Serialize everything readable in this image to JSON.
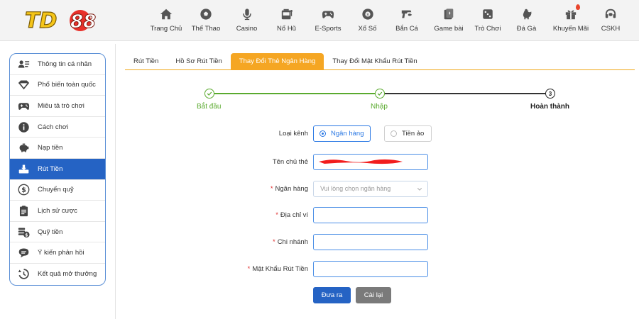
{
  "brand": {
    "logo_text": "TD88",
    "logo_color": "#f5c518"
  },
  "nav": [
    {
      "label": "Trang Chủ",
      "icon": "home-icon"
    },
    {
      "label": "Thể Thao",
      "icon": "soccer-ball-icon"
    },
    {
      "label": "Casino",
      "icon": "microphone-icon"
    },
    {
      "label": "Nổ Hũ",
      "icon": "slot-machine-icon"
    },
    {
      "label": "E-Sports",
      "icon": "gamepad-icon"
    },
    {
      "label": "Xổ Số",
      "icon": "lottery-ball-icon"
    },
    {
      "label": "Bắn Cá",
      "icon": "fish-gun-icon"
    },
    {
      "label": "Game bài",
      "icon": "cards-icon"
    },
    {
      "label": "Trò Chơi",
      "icon": "dice-icon"
    },
    {
      "label": "Đá Gà",
      "icon": "rooster-icon"
    },
    {
      "label": "Khuyến Mãi",
      "icon": "gift-icon"
    },
    {
      "label": "CSKH",
      "icon": "headset-icon"
    }
  ],
  "sidebar": {
    "items": [
      {
        "label": "Thông tin cá nhân",
        "icon": "user-card-icon"
      },
      {
        "label": "Phổ biến toàn quốc",
        "icon": "diamond-icon"
      },
      {
        "label": "Miêu tả trò chơi",
        "icon": "gamepad-icon"
      },
      {
        "label": "Cách chơi",
        "icon": "info-icon"
      },
      {
        "label": "Nạp tiền",
        "icon": "piggy-bank-icon"
      },
      {
        "label": "Rút Tiền",
        "icon": "withdraw-icon"
      },
      {
        "label": "Chuyển quỹ",
        "icon": "dollar-circle-icon"
      },
      {
        "label": "Lịch sử cược",
        "icon": "clipboard-icon"
      },
      {
        "label": "Quỹ tiền",
        "icon": "coins-icon"
      },
      {
        "label": "Ý kiến phản hồi",
        "icon": "chat-bubble-icon"
      },
      {
        "label": "Kết quả mở thưởng",
        "icon": "history-icon"
      }
    ],
    "active_index": 5
  },
  "tabs": [
    {
      "label": "Rút Tiền"
    },
    {
      "label": "Hồ Sơ Rút Tiền"
    },
    {
      "label": "Thay Đổi Thẻ Ngân Hàng"
    },
    {
      "label": "Thay Đổi Mật Khẩu Rút Tiền"
    }
  ],
  "active_tab": 2,
  "steps": [
    {
      "label": "Bắt đầu",
      "state": "done"
    },
    {
      "label": "Nhập",
      "state": "done"
    },
    {
      "label": "Hoàn thành",
      "number": "3",
      "state": "current"
    }
  ],
  "form": {
    "channel_label": "Loại kênh",
    "channel_options": [
      "Ngân hàng",
      "Tiền ảo"
    ],
    "channel_selected": "Ngân hàng",
    "holder_label": "Tên chủ thẻ",
    "bank_label": "Ngân hàng",
    "bank_placeholder": "Vui lòng chọn ngân hàng",
    "wallet_label": "Địa chỉ ví",
    "branch_label": "Chi nhánh",
    "password_label": "Mật Khẩu Rút Tiền",
    "submit_label": "Đưa ra",
    "reset_label": "Cài lại"
  },
  "colors": {
    "accent": "#f5a623",
    "primary": "#2563c4",
    "success": "#5aaa2e",
    "required": "#e03030"
  }
}
